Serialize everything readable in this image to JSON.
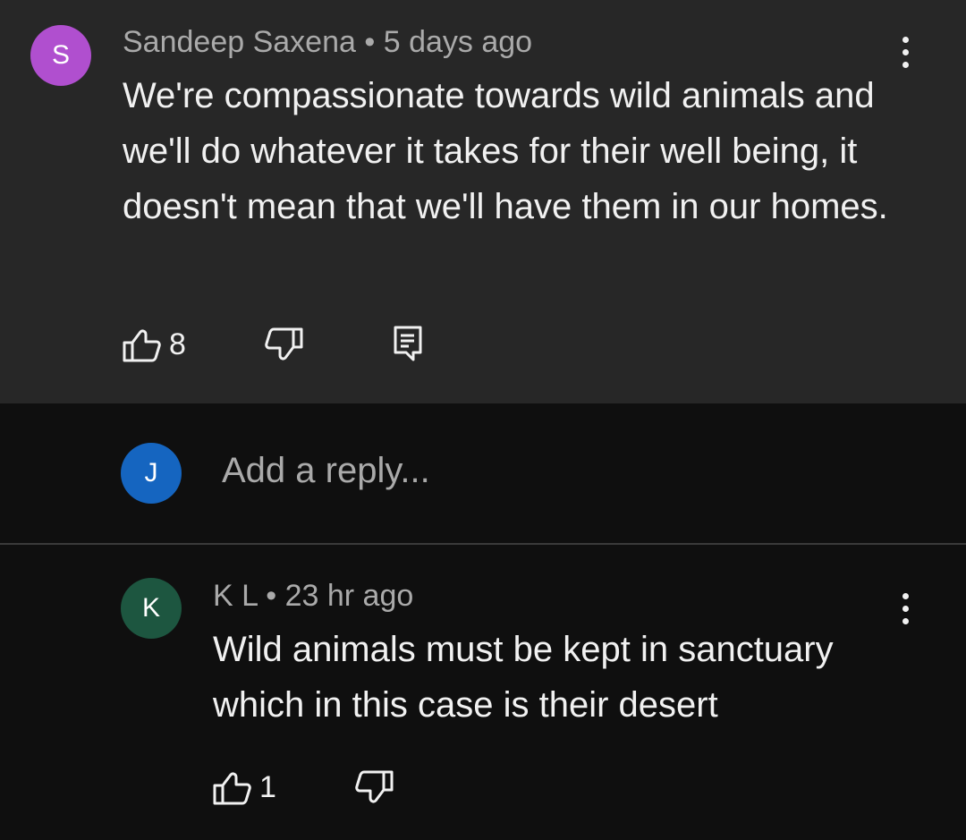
{
  "parent_comment": {
    "avatar_letter": "S",
    "avatar_color": "#b04fcf",
    "author": "Sandeep Saxena",
    "separator": "•",
    "time": "5 days ago",
    "text": "We're compassionate towards wild animals and we'll do whatever it takes for their well being, it doesn't mean that we'll have them in our homes.",
    "like_count": "8",
    "icons": [
      "thumbs-up-icon",
      "thumbs-down-icon",
      "reply-comment-icon",
      "more-vert-icon"
    ]
  },
  "reply_box": {
    "avatar_letter": "J",
    "avatar_color": "#1565c0",
    "placeholder": "Add a reply..."
  },
  "reply_comment": {
    "avatar_letter": "K",
    "avatar_color": "#1d5640",
    "author": "K L",
    "separator": "•",
    "time": "23 hr ago",
    "text": "Wild animals must be kept in sanctuary which in this case is their desert",
    "like_count": "1",
    "icons": [
      "thumbs-up-icon",
      "thumbs-down-icon",
      "more-vert-icon"
    ]
  }
}
